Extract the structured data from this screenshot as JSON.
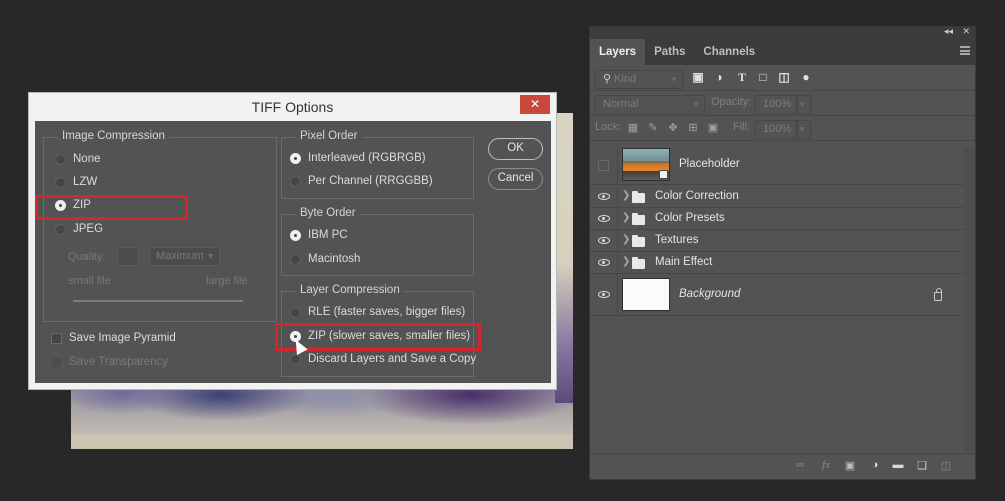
{
  "dialog": {
    "title": "TIFF Options",
    "close_label": "✕",
    "image_compression": {
      "label": "Image Compression",
      "options": [
        {
          "label": "None",
          "checked": false
        },
        {
          "label": "LZW",
          "checked": false
        },
        {
          "label": "ZIP",
          "checked": true
        },
        {
          "label": "JPEG",
          "checked": false
        }
      ],
      "quality_label": "Quality:",
      "quality_value": "",
      "quality_select": "Maximum",
      "small_file_label": "small file",
      "large_file_label": "large file"
    },
    "save_image_pyramid": {
      "label": "Save Image Pyramid",
      "checked": false
    },
    "save_transparency": {
      "label": "Save Transparency",
      "checked": false,
      "disabled": true
    },
    "pixel_order": {
      "label": "Pixel Order",
      "options": [
        {
          "label": "Interleaved (RGBRGB)",
          "checked": true
        },
        {
          "label": "Per Channel (RRGGBB)",
          "checked": false
        }
      ]
    },
    "byte_order": {
      "label": "Byte Order",
      "options": [
        {
          "label": "IBM PC",
          "checked": true
        },
        {
          "label": "Macintosh",
          "checked": false
        }
      ]
    },
    "layer_compression": {
      "label": "Layer Compression",
      "options": [
        {
          "label": "RLE (faster saves, bigger files)",
          "checked": false
        },
        {
          "label": "ZIP (slower saves, smaller files)",
          "checked": true
        },
        {
          "label": "Discard Layers and Save a Copy",
          "checked": false
        }
      ]
    },
    "ok_label": "OK",
    "cancel_label": "Cancel",
    "highlight_color": "#d72530"
  },
  "layers_panel": {
    "collapse_label": "◂◂",
    "close_label": "✕",
    "tabs": [
      {
        "label": "Layers",
        "active": true
      },
      {
        "label": "Paths",
        "active": false
      },
      {
        "label": "Channels",
        "active": false
      }
    ],
    "filter": {
      "kind_label": "Kind",
      "icons": [
        "image-filter-icon",
        "adjustment-filter-icon",
        "type-filter-icon",
        "shape-filter-icon",
        "smart-object-filter-icon",
        "filter-toggle-icon"
      ]
    },
    "blend_mode": "Normal",
    "opacity_label": "Opacity:",
    "opacity_value": "100%",
    "lock_label": "Lock:",
    "fill_label": "Fill:",
    "fill_value": "100%",
    "layers": [
      {
        "name": "Placeholder",
        "type": "smart-object",
        "visible": false
      },
      {
        "name": "Color Correction",
        "type": "group",
        "visible": true
      },
      {
        "name": "Color Presets",
        "type": "group",
        "visible": true
      },
      {
        "name": "Textures",
        "type": "group",
        "visible": true
      },
      {
        "name": "Main Effect",
        "type": "group",
        "visible": true
      },
      {
        "name": "Background",
        "type": "background",
        "visible": true,
        "locked": true
      }
    ],
    "bottom_icons": [
      "link-layers-icon",
      "fx-icon",
      "add-mask-icon",
      "new-adjustment-layer-icon",
      "new-group-icon",
      "new-layer-icon",
      "delete-layer-icon"
    ]
  }
}
